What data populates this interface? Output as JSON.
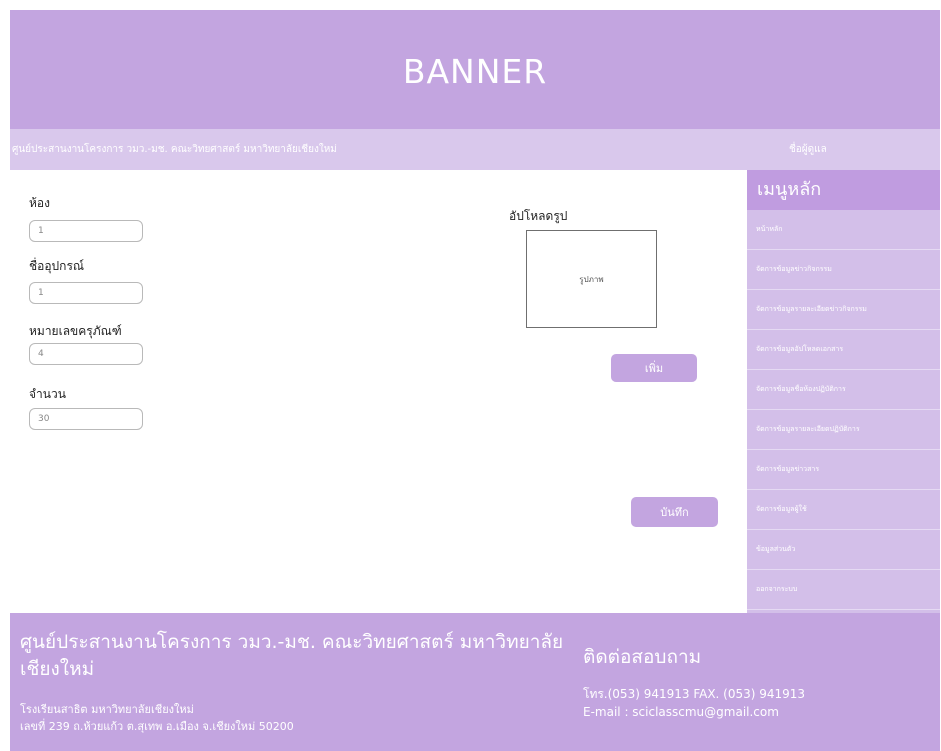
{
  "banner": {
    "title": "BANNER"
  },
  "topbar": {
    "org_text": "ศูนย์ประสานงานโครงการ วมว.-มช. คณะวิทยศาสตร์ มหาวิทยาลัยเชียงใหม่",
    "username": "ชื่อผู้ดูแล"
  },
  "form": {
    "room_label": "ห้อง",
    "room_value": "1",
    "equipment_label": "ชื่ออุปกรณ์",
    "equipment_value": "1",
    "serial_label": "หมายเลขครุภัณฑ์",
    "serial_value": "4",
    "quantity_label": "จำนวน",
    "quantity_value": "30",
    "upload_label": "อัปโหลดรูป",
    "image_placeholder": "รูปภาพ",
    "add_button": "เพิ่ม",
    "save_button": "บันทึก"
  },
  "sidebar": {
    "heading": "เมนูหลัก",
    "items": [
      {
        "label": "หน้าหลัก"
      },
      {
        "label": "จัดการข้อมูลข่าวกิจกรรม"
      },
      {
        "label": "จัดการข้อมูลรายละเอียดข่าวกิจกรรม"
      },
      {
        "label": "จัดการข้อมูลอัปโหลดเอกสาร"
      },
      {
        "label": "จัดการข้อมูลชื่อห้องปฏิบัติการ"
      },
      {
        "label": "จัดการข้อมูลรายละเอียดปฏิบัติการ"
      },
      {
        "label": "จัดการข้อมูลข่าวสาร"
      },
      {
        "label": "จัดการข้อมูลผู้ใช้"
      },
      {
        "label": "ข้อมูลส่วนตัว"
      },
      {
        "label": "ออกจากระบบ"
      }
    ]
  },
  "footer": {
    "org_title": "ศูนย์ประสานงานโครงการ วมว.-มช. คณะวิทยศาสตร์ มหาวิทยาลัยเชียงใหม่",
    "school": "โรงเรียนสาธิต มหาวิทยาลัยเชียงใหม่",
    "address": "เลขที่ 239 ถ.ห้วยแก้ว ต.สุเทพ อ.เมือง จ.เชียงใหม่ 50200",
    "contact_title": "ติดต่อสอบถาม",
    "phone": "โทร.(053) 941913 FAX. (053) 941913",
    "email": "E-mail : sciclasscmu@gmail.com"
  },
  "colors": {
    "primary": "#c3a5e0",
    "sidebar_head": "#c09ce0",
    "sidebar_bg": "#d3bfe9",
    "topbar_bg": "#d9c8ec"
  }
}
